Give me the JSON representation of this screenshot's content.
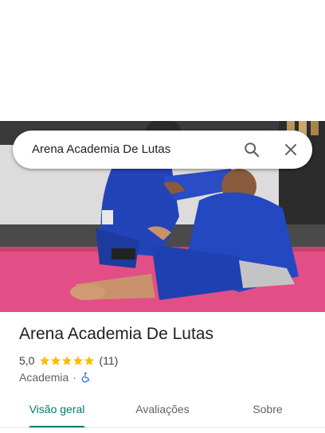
{
  "search": {
    "query": "Arena Academia De Lutas"
  },
  "icons": {
    "search": "search-icon",
    "close": "close-icon",
    "star": "star-icon",
    "wheelchair": "wheelchair-accessible-icon"
  },
  "place": {
    "name": "Arena Academia De Lutas",
    "rating": "5,0",
    "stars": 5,
    "review_count": "(11)",
    "category": "Academia",
    "separator": "·"
  },
  "tabs": [
    {
      "label": "Visão geral",
      "active": true
    },
    {
      "label": "Avaliações",
      "active": false
    },
    {
      "label": "Sobre",
      "active": false
    }
  ],
  "colors": {
    "accent": "#01796f",
    "star": "#fbbc04",
    "accessibility": "#1a73e8",
    "mat": "#e24f86",
    "gi": "#2244b8"
  }
}
